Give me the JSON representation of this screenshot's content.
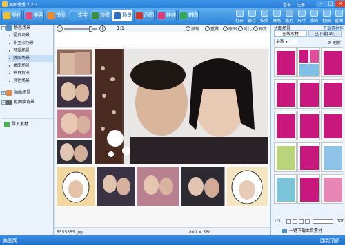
{
  "titlebar": {
    "title": "美图秀秀 2.2.3",
    "login": "登录",
    "signup": "注册",
    "min": "–",
    "max": "□",
    "close": "×"
  },
  "tabs": [
    {
      "label": "美化",
      "color": "#f0c02f"
    },
    {
      "label": "美容",
      "color": "#e24d80"
    },
    {
      "label": "饰品",
      "color": "#f08a2c"
    },
    {
      "label": "文字",
      "color": "#45a1e8"
    },
    {
      "label": "边框",
      "color": "#3c8f3c"
    },
    {
      "label": "场景",
      "color": "#2b6cc4"
    },
    {
      "label": "闪图",
      "color": "#d6372b"
    },
    {
      "label": "娃娃",
      "color": "#e0397a"
    },
    {
      "label": "拼图",
      "color": "#32a853"
    }
  ],
  "toolbar": [
    "打开",
    "保存",
    "拍照",
    "缩略",
    "裁剪",
    "尺寸",
    "涂鸦",
    "抠图",
    "看图"
  ],
  "left_panel": {
    "static": "静态场景",
    "static_items": [
      "逼真场景",
      "非主流场景",
      "可爱场景",
      "拼图场景",
      "桌面场景",
      "节日贺卡",
      "其他场景"
    ],
    "anim": "动画场景",
    "cutout": "抠图换背景",
    "import": "导入素材"
  },
  "canvas_toolbar": {
    "zoom_out": "−",
    "zoom_in": "+",
    "ratio": "1:1",
    "undo": "撤销",
    "redo": "重做",
    "original": "原图",
    "compare": "对比",
    "preview": "预览"
  },
  "canvas_status": {
    "file": "5555555.jpg",
    "size": "800 × 560"
  },
  "right_panel": {
    "title": "拼图场景",
    "download_link": "下载素材包",
    "tab_online": "在线素材",
    "tab_downloaded": "已下载[19]",
    "filter": "最新",
    "refresh": "刷新",
    "pager": "1/3",
    "go": "GO",
    "download_bar": "一键下载本页素材",
    "thumb_color": "#c8177d"
  },
  "bottombar": {
    "left": "美图网",
    "right": "回到顶部"
  }
}
